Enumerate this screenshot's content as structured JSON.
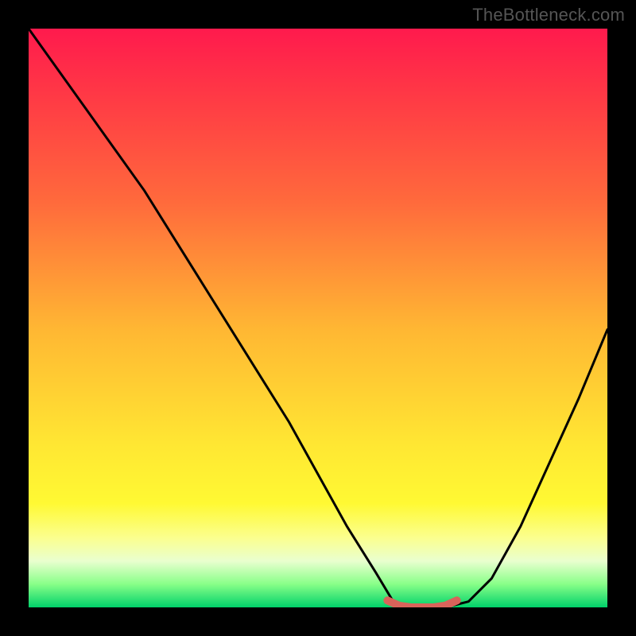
{
  "watermark": "TheBottleneck.com",
  "chart_data": {
    "type": "line",
    "title": "",
    "xlabel": "",
    "ylabel": "",
    "xlim": [
      0,
      100
    ],
    "ylim": [
      0,
      100
    ],
    "series": [
      {
        "name": "bottleneck-curve",
        "x": [
          0,
          5,
          10,
          15,
          20,
          25,
          30,
          35,
          40,
          45,
          50,
          55,
          60,
          63,
          66,
          69,
          72,
          76,
          80,
          85,
          90,
          95,
          100
        ],
        "values": [
          100,
          93,
          86,
          79,
          72,
          64,
          56,
          48,
          40,
          32,
          23,
          14,
          6,
          1,
          0,
          0,
          0,
          1,
          5,
          14,
          25,
          36,
          48
        ]
      },
      {
        "name": "optimal-band",
        "x": [
          62,
          64,
          66,
          68,
          70,
          72,
          74
        ],
        "values": [
          1.2,
          0.3,
          0,
          0,
          0,
          0.3,
          1.2
        ]
      }
    ],
    "optimal_range": {
      "start": 63,
      "end": 73
    },
    "colors": {
      "curve": "#000000",
      "optimal_band": "#d9635a",
      "gradient_top": "#ff1a4d",
      "gradient_mid": "#ffe733",
      "gradient_bottom": "#00d16a"
    }
  }
}
